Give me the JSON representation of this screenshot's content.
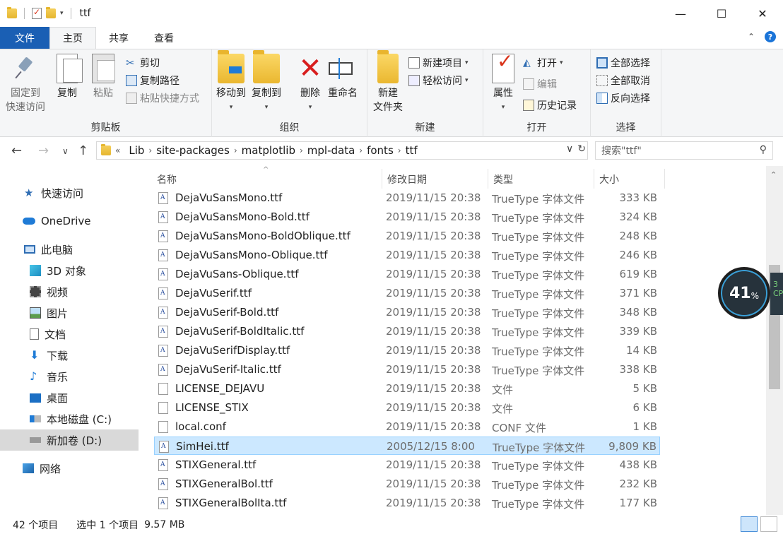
{
  "window": {
    "title": "ttf",
    "minimize": "—",
    "maximize": "☐",
    "close": "✕"
  },
  "ribbon_tabs": [
    {
      "label": "文件"
    },
    {
      "label": "主页"
    },
    {
      "label": "共享"
    },
    {
      "label": "查看"
    }
  ],
  "ribbon": {
    "clipboard": {
      "label": "剪贴板",
      "pin": "固定到\n快速访问",
      "copy": "复制",
      "paste": "粘贴",
      "cut": "剪切",
      "copy_path": "复制路径",
      "paste_shortcut": "粘贴快捷方式"
    },
    "organize": {
      "label": "组织",
      "move_to": "移动到",
      "copy_to": "复制到",
      "delete": "删除",
      "rename": "重命名"
    },
    "new": {
      "label": "新建",
      "new_folder": "新建\n文件夹",
      "new_item": "新建项目",
      "easy_access": "轻松访问"
    },
    "open": {
      "label": "打开",
      "properties": "属性",
      "open": "打开",
      "edit": "编辑",
      "history": "历史记录"
    },
    "select": {
      "label": "选择",
      "select_all": "全部选择",
      "select_none": "全部取消",
      "invert": "反向选择"
    }
  },
  "address": {
    "prefix": "«",
    "segments": [
      "Lib",
      "site-packages",
      "matplotlib",
      "mpl-data",
      "fonts",
      "ttf"
    ],
    "search_placeholder": "搜索\"ttf\""
  },
  "sidebar": {
    "items": [
      {
        "label": "快速访问",
        "icon": "star-icon"
      },
      {
        "label": "OneDrive",
        "icon": "cloud-icon"
      },
      {
        "label": "此电脑",
        "icon": "computer-icon"
      },
      {
        "label": "3D 对象",
        "icon": "cube-icon"
      },
      {
        "label": "视频",
        "icon": "video-icon"
      },
      {
        "label": "图片",
        "icon": "picture-icon"
      },
      {
        "label": "文档",
        "icon": "document-icon"
      },
      {
        "label": "下载",
        "icon": "download-icon"
      },
      {
        "label": "音乐",
        "icon": "music-icon"
      },
      {
        "label": "桌面",
        "icon": "desktop-icon"
      },
      {
        "label": "本地磁盘 (C:)",
        "icon": "drive-icon"
      },
      {
        "label": "新加卷 (D:)",
        "icon": "drive-icon"
      },
      {
        "label": "网络",
        "icon": "network-icon"
      }
    ]
  },
  "columns": {
    "name": "名称",
    "date": "修改日期",
    "type": "类型",
    "size": "大小"
  },
  "files": [
    {
      "name": "DejaVuSansMono.ttf",
      "date": "2019/11/15 20:38",
      "type": "TrueType 字体文件",
      "size": "333 KB",
      "kind": "ttf"
    },
    {
      "name": "DejaVuSansMono-Bold.ttf",
      "date": "2019/11/15 20:38",
      "type": "TrueType 字体文件",
      "size": "324 KB",
      "kind": "ttf"
    },
    {
      "name": "DejaVuSansMono-BoldOblique.ttf",
      "date": "2019/11/15 20:38",
      "type": "TrueType 字体文件",
      "size": "248 KB",
      "kind": "ttf"
    },
    {
      "name": "DejaVuSansMono-Oblique.ttf",
      "date": "2019/11/15 20:38",
      "type": "TrueType 字体文件",
      "size": "246 KB",
      "kind": "ttf"
    },
    {
      "name": "DejaVuSans-Oblique.ttf",
      "date": "2019/11/15 20:38",
      "type": "TrueType 字体文件",
      "size": "619 KB",
      "kind": "ttf"
    },
    {
      "name": "DejaVuSerif.ttf",
      "date": "2019/11/15 20:38",
      "type": "TrueType 字体文件",
      "size": "371 KB",
      "kind": "ttf"
    },
    {
      "name": "DejaVuSerif-Bold.ttf",
      "date": "2019/11/15 20:38",
      "type": "TrueType 字体文件",
      "size": "348 KB",
      "kind": "ttf"
    },
    {
      "name": "DejaVuSerif-BoldItalic.ttf",
      "date": "2019/11/15 20:38",
      "type": "TrueType 字体文件",
      "size": "339 KB",
      "kind": "ttf"
    },
    {
      "name": "DejaVuSerifDisplay.ttf",
      "date": "2019/11/15 20:38",
      "type": "TrueType 字体文件",
      "size": "14 KB",
      "kind": "ttf"
    },
    {
      "name": "DejaVuSerif-Italic.ttf",
      "date": "2019/11/15 20:38",
      "type": "TrueType 字体文件",
      "size": "338 KB",
      "kind": "ttf"
    },
    {
      "name": "LICENSE_DEJAVU",
      "date": "2019/11/15 20:38",
      "type": "文件",
      "size": "5 KB",
      "kind": "file"
    },
    {
      "name": "LICENSE_STIX",
      "date": "2019/11/15 20:38",
      "type": "文件",
      "size": "6 KB",
      "kind": "file"
    },
    {
      "name": "local.conf",
      "date": "2019/11/15 20:38",
      "type": "CONF 文件",
      "size": "1 KB",
      "kind": "file"
    },
    {
      "name": "SimHei.ttf",
      "date": "2005/12/15 8:00",
      "type": "TrueType 字体文件",
      "size": "9,809 KB",
      "kind": "ttf",
      "selected": true
    },
    {
      "name": "STIXGeneral.ttf",
      "date": "2019/11/15 20:38",
      "type": "TrueType 字体文件",
      "size": "438 KB",
      "kind": "ttf"
    },
    {
      "name": "STIXGeneralBol.ttf",
      "date": "2019/11/15 20:38",
      "type": "TrueType 字体文件",
      "size": "232 KB",
      "kind": "ttf"
    },
    {
      "name": "STIXGeneralBolIta.ttf",
      "date": "2019/11/15 20:38",
      "type": "TrueType 字体文件",
      "size": "177 KB",
      "kind": "ttf"
    }
  ],
  "status": {
    "count": "42 个项目",
    "selected": "选中 1 个项目",
    "selected_size": "9.57 MB"
  },
  "overlay": {
    "value": "41",
    "unit": "%",
    "side_text": "3\nCP"
  },
  "colors": {
    "file_tab": "#1a5fb4",
    "selection_bg": "#cce8ff",
    "selection_border": "#99d1ff"
  }
}
